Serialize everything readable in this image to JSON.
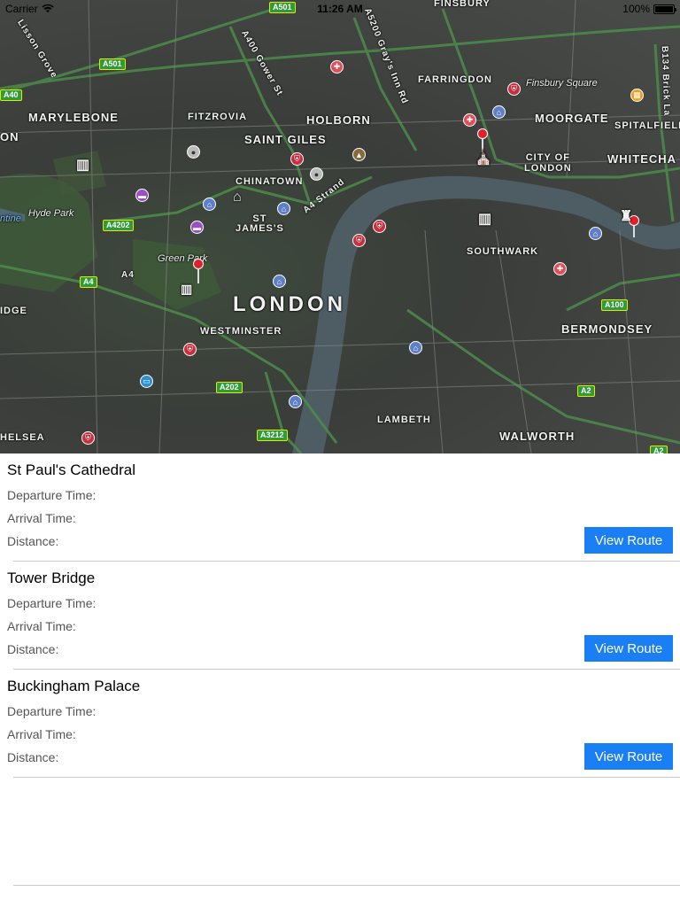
{
  "status_bar": {
    "carrier": "Carrier",
    "time": "11:26 AM",
    "battery": "100%"
  },
  "map": {
    "areas": {
      "marylebone": "MARYLEBONE",
      "fitzrovia": "FITZROVIA",
      "holborn": "HOLBORN",
      "saint_giles": "SAINT GILES",
      "chinatown": "CHINATOWN",
      "st_james": "ST\nJAMES'S",
      "london": "LONDON",
      "westminster": "WESTMINSTER",
      "lambeth": "LAMBETH",
      "southwark": "SOUTHWARK",
      "bermondsey": "BERMONDSEY",
      "walworth": "WALWORTH",
      "moorgate": "MOORGATE",
      "farringdon": "FARRINGDON",
      "finsbury": "FINSBURY",
      "spitalfields": "SPITALFIELDS",
      "whitechapel": "WHITECHA",
      "city_of_london": "CITY OF\nLONDON",
      "chelsea": "HELSEA",
      "bridge": "IDGE",
      "on": "ON"
    },
    "parks": {
      "hyde_park": "Hyde Park",
      "green_park": "Green Park",
      "finsbury_square": "Finsbury Square",
      "serpentine": "ntine"
    },
    "streets": {
      "lisson_grove": "Lisson Grove",
      "a400": "A400 Gower St",
      "a5200": "A5200 Gray's Inn Rd",
      "a4_strand": "A4 Strand",
      "b134": "B134 Brick La",
      "a4": "A4"
    },
    "road_badges": {
      "a501_top": "A501",
      "a501": "A501",
      "a40": "A40",
      "a4202": "A4202",
      "a4": "A4",
      "a202": "A202",
      "a3212": "A3212",
      "a100": "A100",
      "a2": "A2",
      "a2b": "A2"
    }
  },
  "destinations": [
    {
      "name": "St Paul's Cathedral",
      "departure_label": "Departure Time:",
      "arrival_label": "Arrival Time:",
      "distance_label": "Distance:",
      "button_label": "View Route"
    },
    {
      "name": "Tower Bridge",
      "departure_label": "Departure Time:",
      "arrival_label": "Arrival Time:",
      "distance_label": "Distance:",
      "button_label": "View Route"
    },
    {
      "name": "Buckingham Palace",
      "departure_label": "Departure Time:",
      "arrival_label": "Arrival Time:",
      "distance_label": "Distance:",
      "button_label": "View Route"
    }
  ]
}
